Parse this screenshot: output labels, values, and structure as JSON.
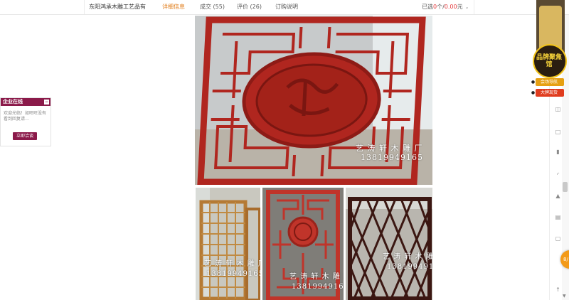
{
  "topbar": {
    "shop_name": "东阳鸿承木雕工艺品有",
    "tabs": [
      {
        "label": "详细信息",
        "active": true
      },
      {
        "label": "成交 (55)",
        "active": false
      },
      {
        "label": "评价 (26)",
        "active": false
      },
      {
        "label": "订购说明",
        "active": false
      }
    ],
    "selected_prefix": "已选",
    "selected_count": "0",
    "selected_unit": "个/",
    "selected_amount": "0.00",
    "selected_currency": "元",
    "accent_color": "#e07a14"
  },
  "photos": {
    "main_watermark_name": "艺 涛 轩 木 雕 厂",
    "main_watermark_phone": "13819949165",
    "thumb1_name": "艺 涛 轩 木 雕 厂",
    "thumb1_phone": "13819949165",
    "thumb2_name": "艺 涛 轩 木 雕 厂",
    "thumb2_phone": "13819949165",
    "thumb3_name": "艺 涛 轩 木 雕 厂",
    "thumb3_phone": "13819949165",
    "main_panel_color": "#b0261f",
    "thumb3_panel_color": "#3b1712"
  },
  "chat": {
    "title": "企业在线",
    "message": "欢迎光临！如旺旺没有看到回复请…",
    "button": "立即洽谈",
    "theme_color": "#8b1a4a"
  },
  "badge": {
    "title": "品牌聚焦馆",
    "nav_label": "会场导航",
    "promo_label": "大牌现货",
    "float_label": "8/"
  }
}
